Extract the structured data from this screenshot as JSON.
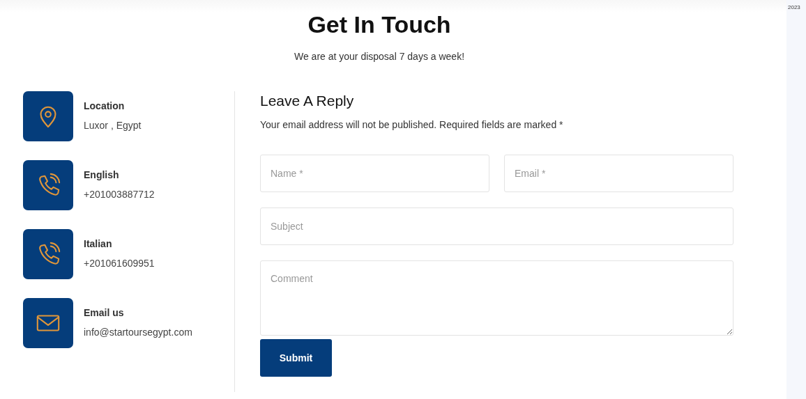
{
  "side_strip": {
    "text": "2023"
  },
  "header": {
    "title": "Get In Touch",
    "subtitle": "We are at your disposal 7 days a week!"
  },
  "contacts": [
    {
      "kind": "location",
      "label": "Location",
      "value": "Luxor , Egypt"
    },
    {
      "kind": "phone",
      "label": "English",
      "value": "+201003887712"
    },
    {
      "kind": "phone",
      "label": "Italian",
      "value": "+201061609951"
    },
    {
      "kind": "email",
      "label": "Email us",
      "value": "info@startoursegypt.com"
    }
  ],
  "form": {
    "title": "Leave A Reply",
    "note": "Your email address will not be published. Required fields are marked *",
    "field_rows": [
      [
        {
          "kind": "input",
          "placeholder": "Name *"
        },
        {
          "kind": "input",
          "placeholder": "Email *"
        }
      ],
      [
        {
          "kind": "input",
          "placeholder": "Subject"
        }
      ],
      [
        {
          "kind": "textarea",
          "placeholder": "Comment"
        }
      ]
    ],
    "submit": "Submit"
  }
}
